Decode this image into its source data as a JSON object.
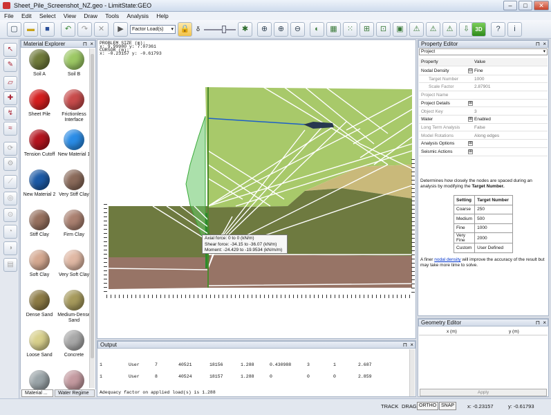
{
  "window": {
    "title": "Sheet_Pile_Screenshot_NZ.geo - LimitState:GEO",
    "min": "–",
    "max": "□",
    "close": "✕"
  },
  "menu": [
    "File",
    "Edit",
    "Select",
    "View",
    "Draw",
    "Tools",
    "Analysis",
    "Help"
  ],
  "toolbar": {
    "load_select": "Factor Load(s)",
    "delta": "δ"
  },
  "material_explorer": {
    "title": "Material Explorer",
    "tabs": [
      "Material ...",
      "Water Regime ..."
    ],
    "items": [
      {
        "label": "Soil A",
        "color": "#6f7a3a"
      },
      {
        "label": "Soil B",
        "color": "#9cc864"
      },
      {
        "label": "Sheet Pile",
        "color": "#d41e1e"
      },
      {
        "label": "Frictionless Interface",
        "color": "#c84b4b"
      },
      {
        "label": "Tension Cutoff",
        "color": "#b4141e"
      },
      {
        "label": "New Material 1",
        "color": "#2a8ce6"
      },
      {
        "label": "New Material 2",
        "color": "#1c5aa6"
      },
      {
        "label": "Very Stiff Clay",
        "color": "#8a6a5a"
      },
      {
        "label": "Stiff Clay",
        "color": "#96705e"
      },
      {
        "label": "Firm Clay",
        "color": "#aa8070"
      },
      {
        "label": "Soft Clay",
        "color": "#d4a890"
      },
      {
        "label": "Very Soft Clay",
        "color": "#e0b8a4"
      },
      {
        "label": "Dense Sand",
        "color": "#8c7a44"
      },
      {
        "label": "Medium-Dense Sand",
        "color": "#a69a5c"
      },
      {
        "label": "Loose Sand",
        "color": "#d8d08c"
      },
      {
        "label": "Concrete",
        "color": "#a8a8a8"
      },
      {
        "label": "",
        "color": "#9aa4a8"
      },
      {
        "label": "",
        "color": "#c49aa0"
      }
    ]
  },
  "canvas": {
    "problem_size_label": "PROBLEM SIZE (m):",
    "problem_size": "x: 9.99980 y: 7.07361",
    "cursor_label": "CURSOR (m):",
    "cursor": "x: -0.23157 y: -0.61793",
    "tooltip": [
      "Axial force: 0 to 0 (kN/m)",
      "Shear force: -34.15 to -36.07 (kN/m)",
      "Moment: -24.429 to -19.9534 (kN/m/m)"
    ],
    "colors": {
      "soil_b": "#a8c96a",
      "soil_a": "#6e7a40",
      "clay": "#977466",
      "sand": "#c9b97a",
      "pile": "#2c8a2c",
      "lines": "#ffffff"
    }
  },
  "output": {
    "title": "Output",
    "rows": [
      [
        "1",
        "User",
        "7",
        "40521",
        "18156",
        "1.288",
        "0.430988",
        "3",
        "1",
        "2.687"
      ],
      [
        "1",
        "User",
        "8",
        "40524",
        "18157",
        "1.288",
        "0",
        "0",
        "0",
        "2.859"
      ]
    ],
    "summary": "Adequacy factor on applied load(s) is 1.288"
  },
  "property_editor": {
    "title": "Property Editor",
    "selector": "Project",
    "col_property": "Property",
    "col_value": "Value",
    "rows": [
      {
        "k": "Nodal Density",
        "v": "Fine",
        "ex": "⊟",
        "bold": true
      },
      {
        "k": "Target Number",
        "v": "1000",
        "indent": true
      },
      {
        "k": "Scale Factor",
        "v": "2.87901",
        "indent": true
      },
      {
        "k": "Project Name",
        "v": ""
      },
      {
        "k": "Project Details",
        "v": "",
        "ex": "⊞",
        "bold": true
      },
      {
        "k": "Object Key",
        "v": "3"
      },
      {
        "k": "Water",
        "v": "Enabled",
        "ex": "⊞",
        "bold": true
      },
      {
        "k": "Long Term Analysis",
        "v": "False"
      },
      {
        "k": "Model Rotations",
        "v": "Along edges"
      },
      {
        "k": "Analysis Options",
        "v": "",
        "ex": "⊞",
        "bold": true
      },
      {
        "k": "Seismic Actions",
        "v": "",
        "ex": "⊞",
        "bold": true
      }
    ],
    "help_pre": "Determines how closely the nodes are spaced during an analysis by modifying the ",
    "help_bold": "Target Number.",
    "settings_head": [
      "Setting",
      "Target Number"
    ],
    "settings": [
      [
        "Coarse",
        "250"
      ],
      [
        "Medium",
        "500"
      ],
      [
        "Fine",
        "1000"
      ],
      [
        "Very Fine",
        "2000"
      ],
      [
        "Custom",
        "User Defined"
      ]
    ],
    "note_pre": "A finer ",
    "note_link": "nodal density",
    "note_post": " will improve the accuracy of the result but may take more time to solve."
  },
  "geometry_editor": {
    "title": "Geometry Editor",
    "col_x": "x (m)",
    "col_y": "y (m)",
    "apply": "Apply"
  },
  "status": {
    "track": "TRACK",
    "drag": "DRAG",
    "ortho": "ORTHO",
    "snap": "SNAP",
    "x": "x: -0.23157",
    "y": "y: -0.61793"
  }
}
